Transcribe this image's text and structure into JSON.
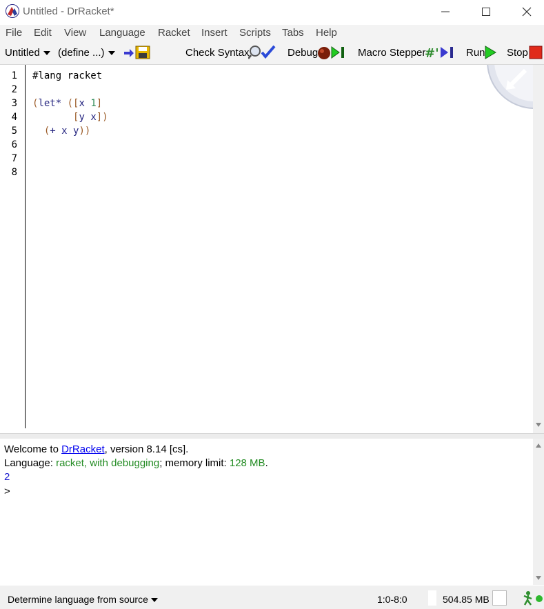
{
  "window": {
    "title": "Untitled - DrRacket*",
    "minimize_icon": "minimize-icon",
    "maximize_icon": "maximize-icon",
    "close_icon": "close-icon"
  },
  "menu": {
    "items": [
      "File",
      "Edit",
      "View",
      "Language",
      "Racket",
      "Insert",
      "Scripts",
      "Tabs",
      "Help"
    ]
  },
  "toolbar": {
    "file_dropdown": "Untitled",
    "define_dropdown": "(define ...)",
    "check_syntax": "Check Syntax",
    "debug": "Debug",
    "macro_stepper": "Macro Stepper",
    "run": "Run",
    "stop": "Stop"
  },
  "editor": {
    "line_numbers": [
      "1",
      "2",
      "3",
      "4",
      "5",
      "6",
      "7",
      "8"
    ],
    "lines": {
      "l1": "#lang racket",
      "l3_paren": "(",
      "l3_kw": "let*",
      "l3_open": " ([",
      "l3_sym": "x",
      "l3_num": "1",
      "l3_close": "]",
      "l4_open": "[",
      "l4_y": "y",
      "l4_x": "x",
      "l4_close": "])",
      "l5_open": "(",
      "l5_plus": "+",
      "l5_x": "x",
      "l5_y": "y",
      "l5_close": "))"
    }
  },
  "repl": {
    "welcome_prefix": "Welcome to ",
    "welcome_link": "DrRacket",
    "welcome_suffix": ", version 8.14 [cs].",
    "language_label": "Language: ",
    "language_value": "racket, with debugging",
    "memory_label": "; memory limit: ",
    "memory_value": "128 MB",
    "memory_end": ".",
    "result": "2",
    "prompt": ">"
  },
  "status": {
    "language_selector": "Determine language from source",
    "position": "1:0-8:0",
    "memory": "504.85 MB"
  },
  "colors": {
    "paren": "#9b5b27",
    "symbol": "#262680",
    "constant": "#2e8b57",
    "repl_green": "#228b22",
    "link": "#0000ee",
    "result_blue": "#1e1ed0"
  }
}
